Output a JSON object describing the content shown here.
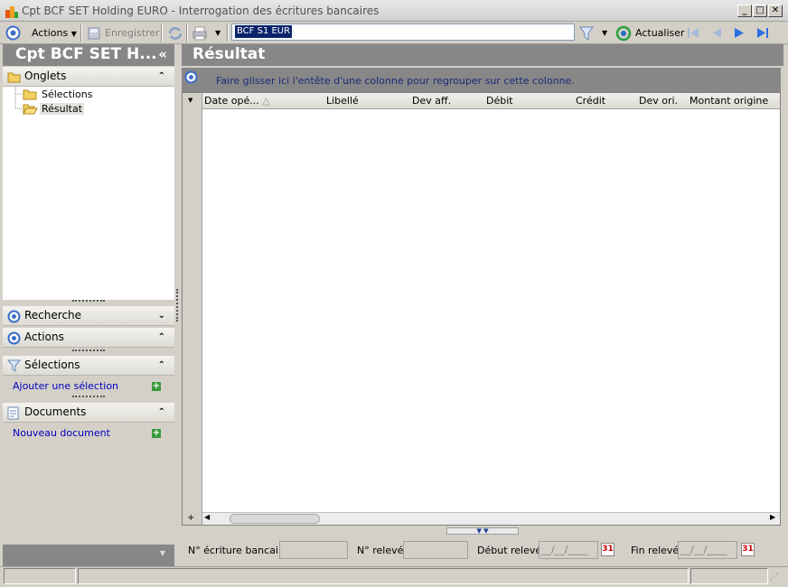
{
  "window": {
    "title": "Cpt BCF SET Holding EURO -  Interrogation des écritures bancaires",
    "min_glyph": "_",
    "max_glyph": "□",
    "close_glyph": "✕"
  },
  "toolbar": {
    "actions_label": "Actions",
    "save_label": "Enregistrer",
    "search_value": "BCF S1 EUR",
    "refresh_label": "Actualiser",
    "icons": [
      "circle-nav-icon",
      "save-icon",
      "sync-icon",
      "print-icon",
      "filter-icon",
      "refresh-icon",
      "first-icon",
      "prev-icon",
      "next-icon",
      "last-icon"
    ]
  },
  "left_panel": {
    "title": "Cpt BCF SET H...",
    "collapse_glyph": "«",
    "tabs_section": "Onglets",
    "tree": [
      "Sélections",
      "Résultat"
    ],
    "sections": {
      "search": "Recherche",
      "actions": "Actions",
      "selections": "Sélections",
      "add_selection": "Ajouter une sélection",
      "documents": "Documents",
      "new_document": "Nouveau document"
    },
    "chevron_up": "«",
    "chevron_down": "»"
  },
  "main": {
    "title": "Résultat",
    "group_hint": "Faire glisser ici l'entête d'une colonne pour regrouper sur cette colonne.",
    "columns": [
      "Date opé...",
      "Libellé",
      "Dev aff.",
      "Débit",
      "Crédit",
      "Dev ori.",
      "Montant origine"
    ]
  },
  "bottom": {
    "entry_label": "N° écriture bancaire :",
    "statement_label": "N° relevé :",
    "start_label": "Début relevé :",
    "end_label": "Fin relevé :",
    "date_placeholder": "__/__/____",
    "calendar_day": "31"
  },
  "colors": {
    "header_gray": "#878787",
    "link_blue": "#0000c0",
    "selection_blue": "#0a246a"
  }
}
